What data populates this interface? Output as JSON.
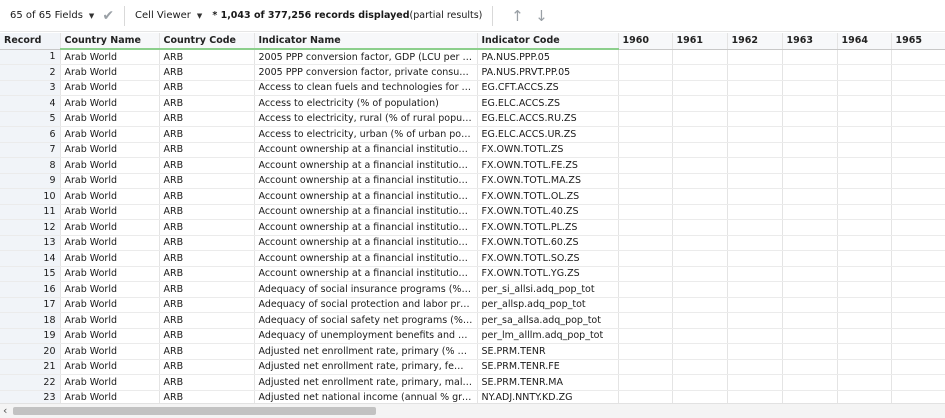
{
  "toolbar": {
    "fields_label": "65 of 65 Fields",
    "viewer_label": "Cell Viewer",
    "status_text": "* 1,043 of 377,256 records displayed",
    "status_suffix": "(partial results)"
  },
  "icons": {
    "dropdown": "chevron-down-icon",
    "check": "check-icon",
    "up": "arrow-up-icon",
    "down": "arrow-down-icon",
    "scroll_left": "chevron-left-icon"
  },
  "colors": {
    "header_highlight": "#8ccf8c",
    "record_bg": "#f1f4f8"
  },
  "table": {
    "columns": [
      "Record",
      "Country Name",
      "Country Code",
      "Indicator Name",
      "Indicator Code",
      "1960",
      "1961",
      "1962",
      "1963",
      "1964",
      "1965"
    ],
    "rows": [
      [
        "1",
        "Arab World",
        "ARB",
        "2005 PPP conversion factor, GDP (LCU per intern...",
        "PA.NUS.PPP.05",
        "",
        "",
        "",
        "",
        "",
        ""
      ],
      [
        "2",
        "Arab World",
        "ARB",
        "2005 PPP conversion factor, private consumption...",
        "PA.NUS.PRVT.PP.05",
        "",
        "",
        "",
        "",
        "",
        ""
      ],
      [
        "3",
        "Arab World",
        "ARB",
        "Access to clean fuels and technologies for cookin...",
        "EG.CFT.ACCS.ZS",
        "",
        "",
        "",
        "",
        "",
        ""
      ],
      [
        "4",
        "Arab World",
        "ARB",
        "Access to electricity (% of population)",
        "EG.ELC.ACCS.ZS",
        "",
        "",
        "",
        "",
        "",
        ""
      ],
      [
        "5",
        "Arab World",
        "ARB",
        "Access to electricity, rural (% of rural population)",
        "EG.ELC.ACCS.RU.ZS",
        "",
        "",
        "",
        "",
        "",
        ""
      ],
      [
        "6",
        "Arab World",
        "ARB",
        "Access to electricity, urban (% of urban populatio...",
        "EG.ELC.ACCS.UR.ZS",
        "",
        "",
        "",
        "",
        "",
        ""
      ],
      [
        "7",
        "Arab World",
        "ARB",
        "Account ownership at a financial institution or wi...",
        "FX.OWN.TOTL.ZS",
        "",
        "",
        "",
        "",
        "",
        ""
      ],
      [
        "8",
        "Arab World",
        "ARB",
        "Account ownership at a financial institution or wi...",
        "FX.OWN.TOTL.FE.ZS",
        "",
        "",
        "",
        "",
        "",
        ""
      ],
      [
        "9",
        "Arab World",
        "ARB",
        "Account ownership at a financial institution or wi...",
        "FX.OWN.TOTL.MA.ZS",
        "",
        "",
        "",
        "",
        "",
        ""
      ],
      [
        "10",
        "Arab World",
        "ARB",
        "Account ownership at a financial institution or wi...",
        "FX.OWN.TOTL.OL.ZS",
        "",
        "",
        "",
        "",
        "",
        ""
      ],
      [
        "11",
        "Arab World",
        "ARB",
        "Account ownership at a financial institution or wi...",
        "FX.OWN.TOTL.40.ZS",
        "",
        "",
        "",
        "",
        "",
        ""
      ],
      [
        "12",
        "Arab World",
        "ARB",
        "Account ownership at a financial institution or wi...",
        "FX.OWN.TOTL.PL.ZS",
        "",
        "",
        "",
        "",
        "",
        ""
      ],
      [
        "13",
        "Arab World",
        "ARB",
        "Account ownership at a financial institution or wi...",
        "FX.OWN.TOTL.60.ZS",
        "",
        "",
        "",
        "",
        "",
        ""
      ],
      [
        "14",
        "Arab World",
        "ARB",
        "Account ownership at a financial institution or wi...",
        "FX.OWN.TOTL.SO.ZS",
        "",
        "",
        "",
        "",
        "",
        ""
      ],
      [
        "15",
        "Arab World",
        "ARB",
        "Account ownership at a financial institution or wi...",
        "FX.OWN.TOTL.YG.ZS",
        "",
        "",
        "",
        "",
        "",
        ""
      ],
      [
        "16",
        "Arab World",
        "ARB",
        "Adequacy of social insurance programs (% of tot...",
        "per_si_allsi.adq_pop_tot",
        "",
        "",
        "",
        "",
        "",
        ""
      ],
      [
        "17",
        "Arab World",
        "ARB",
        "Adequacy of social protection and labor program...",
        "per_allsp.adq_pop_tot",
        "",
        "",
        "",
        "",
        "",
        ""
      ],
      [
        "18",
        "Arab World",
        "ARB",
        "Adequacy of social safety net programs (% of tot...",
        "per_sa_allsa.adq_pop_tot",
        "",
        "",
        "",
        "",
        "",
        ""
      ],
      [
        "19",
        "Arab World",
        "ARB",
        "Adequacy of unemployment benefits and ALMP (...",
        "per_lm_alllm.adq_pop_tot",
        "",
        "",
        "",
        "",
        "",
        ""
      ],
      [
        "20",
        "Arab World",
        "ARB",
        "Adjusted net enrollment rate, primary (% of prim...",
        "SE.PRM.TENR",
        "",
        "",
        "",
        "",
        "",
        ""
      ],
      [
        "21",
        "Arab World",
        "ARB",
        "Adjusted net enrollment rate, primary, female (%...",
        "SE.PRM.TENR.FE",
        "",
        "",
        "",
        "",
        "",
        ""
      ],
      [
        "22",
        "Arab World",
        "ARB",
        "Adjusted net enrollment rate, primary, male (% o...",
        "SE.PRM.TENR.MA",
        "",
        "",
        "",
        "",
        "",
        ""
      ],
      [
        "23",
        "Arab World",
        "ARB",
        "Adjusted net national income (annual % growth)",
        "NY.ADJ.NNTY.KD.ZG",
        "",
        "",
        "",
        "",
        "",
        ""
      ]
    ]
  }
}
